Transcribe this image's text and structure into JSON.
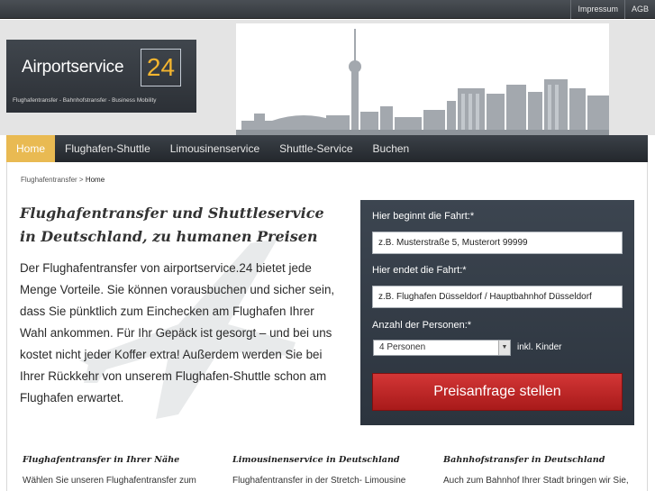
{
  "topbar": {
    "links": [
      "Impressum",
      "AGB"
    ]
  },
  "logo": {
    "name": "Airportservice",
    "number": "24",
    "tagline": "Flughafentransfer - Bahnhofstransfer - Business Mobility"
  },
  "nav": {
    "items": [
      {
        "label": "Home",
        "active": true
      },
      {
        "label": "Flughafen-Shuttle",
        "active": false
      },
      {
        "label": "Limousinenservice",
        "active": false
      },
      {
        "label": "Shuttle-Service",
        "active": false
      },
      {
        "label": "Buchen",
        "active": false
      }
    ]
  },
  "breadcrumb": {
    "parent": "Flughafentransfer",
    "separator": " > ",
    "current": "Home"
  },
  "main": {
    "headline": "Flughafentransfer und Shuttleservice in Deutschland, zu humanen Preisen",
    "intro": "Der Flughafentransfer von airportservice.24 bietet jede Menge Vorteile. Sie können vorausbuchen und sicher sein, dass Sie pünktlich zum Einchecken am Flughafen Ihrer Wahl ankommen. Für Ihr Gepäck ist gesorgt – und bei uns kostet nicht jeder Koffer extra! Außerdem werden Sie bei Ihrer Rückkehr von unserem Flughafen-Shuttle schon am Flughafen erwartet."
  },
  "form": {
    "start_label": "Hier beginnt die Fahrt:*",
    "start_placeholder": "z.B. Musterstraße 5, Musterort 99999",
    "end_label": "Hier endet die Fahrt:*",
    "end_placeholder": "z.B. Flughafen Düsseldorf / Hauptbahnhof Düsseldorf",
    "persons_label": "Anzahl der Personen:*",
    "persons_value": "4 Personen",
    "persons_note": "inkl. Kinder",
    "submit_label": "Preisanfrage stellen"
  },
  "columns": [
    {
      "title": "Flughafentransfer in Ihrer Nähe",
      "text": "Wählen Sie unseren Flughafentransfer zum"
    },
    {
      "title": "Limousinenservice in Deutschland",
      "text": "Flughafentransfer in der Stretch- Limousine"
    },
    {
      "title": "Bahnhofstransfer in Deutschland",
      "text": "Auch zum Bahnhof Ihrer Stadt bringen wir Sie,"
    }
  ],
  "colors": {
    "nav_active": "#e9ba52",
    "logo_number": "#f3b52f",
    "submit": "#c42727",
    "form_bg": "#34404c"
  }
}
